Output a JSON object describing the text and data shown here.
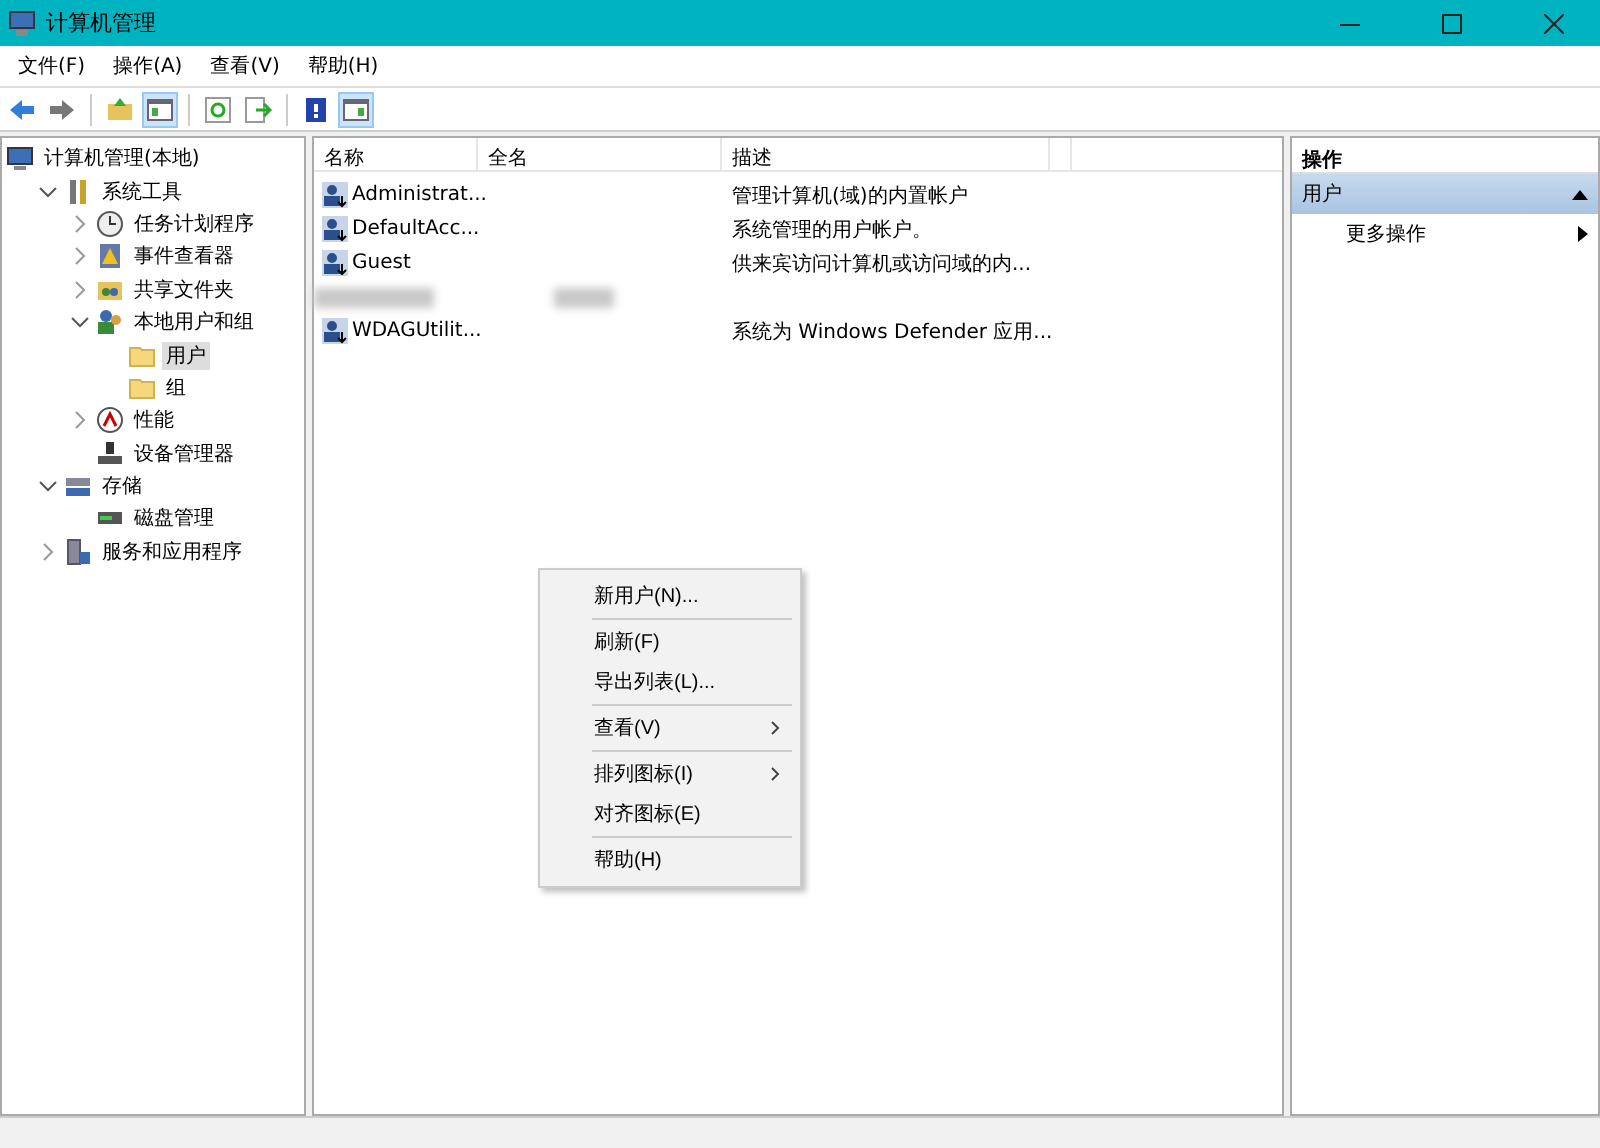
{
  "window": {
    "title": "计算机管理"
  },
  "menubar": [
    "文件(F)",
    "操作(A)",
    "查看(V)",
    "帮助(H)"
  ],
  "toolbar": [
    {
      "kind": "back",
      "selected": false
    },
    {
      "kind": "forward",
      "selected": false
    },
    {
      "kind": "sep"
    },
    {
      "kind": "up",
      "selected": false
    },
    {
      "kind": "pane",
      "selected": true
    },
    {
      "kind": "sep"
    },
    {
      "kind": "refresh",
      "selected": false
    },
    {
      "kind": "export",
      "selected": false
    },
    {
      "kind": "sep"
    },
    {
      "kind": "help",
      "selected": false
    },
    {
      "kind": "pane2",
      "selected": true
    }
  ],
  "tree": [
    {
      "label": "计算机管理(本地)",
      "children": [
        {
          "label": "系统工具",
          "expanded": true,
          "children": [
            {
              "label": "任务计划程序",
              "expanded": false,
              "selected": false
            },
            {
              "label": "事件查看器",
              "expanded": false,
              "selected": false
            },
            {
              "label": "共享文件夹",
              "expanded": false,
              "selected": false
            },
            {
              "label": "本地用户和组",
              "expanded": true,
              "selected": false,
              "children": [
                {
                  "label": "用户",
                  "selected": true
                },
                {
                  "label": "组",
                  "selected": false
                }
              ]
            },
            {
              "label": "性能",
              "expanded": false,
              "selected": false
            },
            {
              "label": "设备管理器",
              "selected": false
            }
          ]
        },
        {
          "label": "存储",
          "expanded": true,
          "children": [
            {
              "label": "磁盘管理",
              "selected": false
            }
          ]
        },
        {
          "label": "服务和应用程序",
          "expanded": false
        }
      ]
    }
  ],
  "table": {
    "columns": [
      "名称",
      "全名",
      "描述"
    ],
    "rows": [
      {
        "kind": "user",
        "name": "Administrat...",
        "description": "管理计算机(域)的内置帐户"
      },
      {
        "kind": "user",
        "name": "DefaultAcc...",
        "description": "系统管理的用户帐户。"
      },
      {
        "kind": "user",
        "name": "Guest",
        "description": "供来宾访问计算机或访问域的内..."
      },
      {
        "kind": "redacted"
      },
      {
        "kind": "user",
        "name": "WDAGUtilit...",
        "description": "系统为 Windows Defender 应用..."
      }
    ]
  },
  "context_menu": [
    {
      "kind": "item",
      "label": "新用户(N)...",
      "submenu": false
    },
    {
      "kind": "sep"
    },
    {
      "kind": "item",
      "label": "刷新(F)",
      "submenu": false
    },
    {
      "kind": "item",
      "label": "导出列表(L)...",
      "submenu": false
    },
    {
      "kind": "sep"
    },
    {
      "kind": "item",
      "label": "查看(V)",
      "submenu": true
    },
    {
      "kind": "sep"
    },
    {
      "kind": "item",
      "label": "排列图标(I)",
      "submenu": true
    },
    {
      "kind": "item",
      "label": "对齐图标(E)",
      "submenu": false
    },
    {
      "kind": "sep"
    },
    {
      "kind": "item",
      "label": "帮助(H)",
      "submenu": false
    }
  ],
  "actions": {
    "title": "操作",
    "sections": [
      {
        "label": "用户",
        "expanded": true,
        "items": [
          {
            "label": "更多操作",
            "submenu": true
          }
        ]
      }
    ]
  }
}
